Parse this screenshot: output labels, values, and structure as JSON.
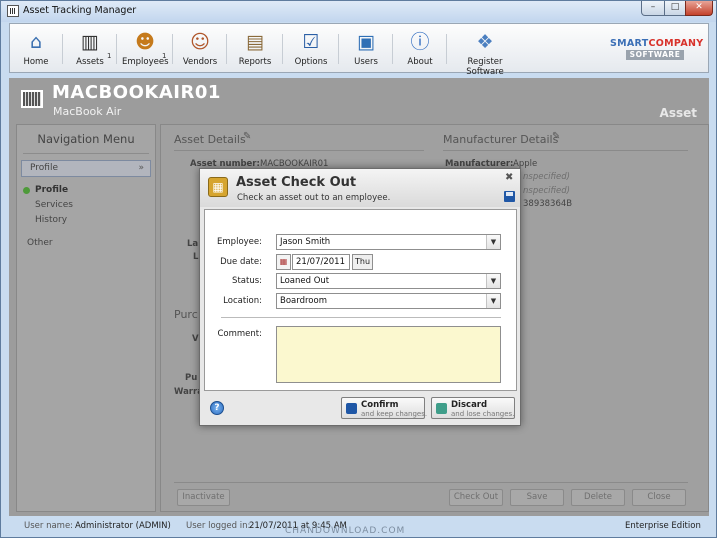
{
  "window": {
    "title": "Asset Tracking Manager",
    "min": "–",
    "max": "□",
    "close": "✕"
  },
  "toolbar": {
    "items": [
      {
        "label": "Home",
        "icon": "home-icon"
      },
      {
        "label": "Assets",
        "icon": "barcode-icon",
        "badge": "1"
      },
      {
        "label": "Employees",
        "icon": "employees-icon",
        "badge": "1"
      },
      {
        "label": "Vendors",
        "icon": "vendors-icon"
      },
      {
        "label": "Reports",
        "icon": "reports-icon"
      },
      {
        "label": "Options",
        "icon": "options-icon"
      },
      {
        "label": "Users",
        "icon": "users-icon"
      },
      {
        "label": "About",
        "icon": "about-icon"
      },
      {
        "label": "Register Software",
        "icon": "register-icon"
      }
    ],
    "logo_smart": "SMART",
    "logo_company": "COMPANY",
    "logo_software": "SOFTWARE"
  },
  "header": {
    "asset_name": "MACBOOKAIR01",
    "model": "MacBook Air",
    "type": "Asset"
  },
  "nav": {
    "title": "Navigation Menu",
    "section": "Profile",
    "chevron": "»",
    "items": [
      "Profile",
      "Services",
      "History"
    ],
    "other": "Other"
  },
  "content": {
    "asset_details_title": "Asset Details",
    "asset_number_label": "Asset number:",
    "asset_number_value": "MACBOOKAIR01",
    "partial_la": "La",
    "partial_l": "L",
    "purchase_partial": "Purc",
    "partial_v": "V",
    "partial_pu": "Pu",
    "partial_warra": "Warra",
    "manufacturer_title": "Manufacturer Details",
    "manufacturer_label": "Manufacturer:",
    "manufacturer_value": "Apple",
    "unspecified1": "nspecified)",
    "unspecified2": "nspecified)",
    "serial_partial": "38938364B",
    "buttons": {
      "inactivate": "Inactivate",
      "check_out": "Check Out",
      "save": "Save",
      "delete": "Delete",
      "close": "Close"
    }
  },
  "status": {
    "user_name_label": "User name:",
    "user_name": "Administrator (ADMIN)",
    "logged_in_label": "User logged in:",
    "logged_in": "21/07/2011 at 9:45 AM",
    "edition": "Enterprise Edition"
  },
  "watermark": "CHANDOWNLOAD.COM",
  "dialog": {
    "title": "Asset Check Out",
    "subtitle": "Check an asset out to an employee.",
    "close": "✖",
    "employee_label": "Employee:",
    "employee_value": "Jason Smith",
    "due_date_label": "Due date:",
    "due_date_value": "21/07/2011",
    "due_date_day": "Thu",
    "status_label": "Status:",
    "status_value": "Loaned Out",
    "location_label": "Location:",
    "location_value": "Boardroom",
    "comment_label": "Comment:",
    "comment_value": "",
    "dropdown_arrow": "▼",
    "help": "?",
    "confirm_label": "Confirm",
    "confirm_sub": "and keep changes.",
    "discard_label": "Discard",
    "discard_sub": "and lose changes."
  },
  "colors": {
    "brand_blue": "#3b6fb6",
    "brand_red": "#d8312a",
    "comment_bg": "#fbf8cf"
  }
}
